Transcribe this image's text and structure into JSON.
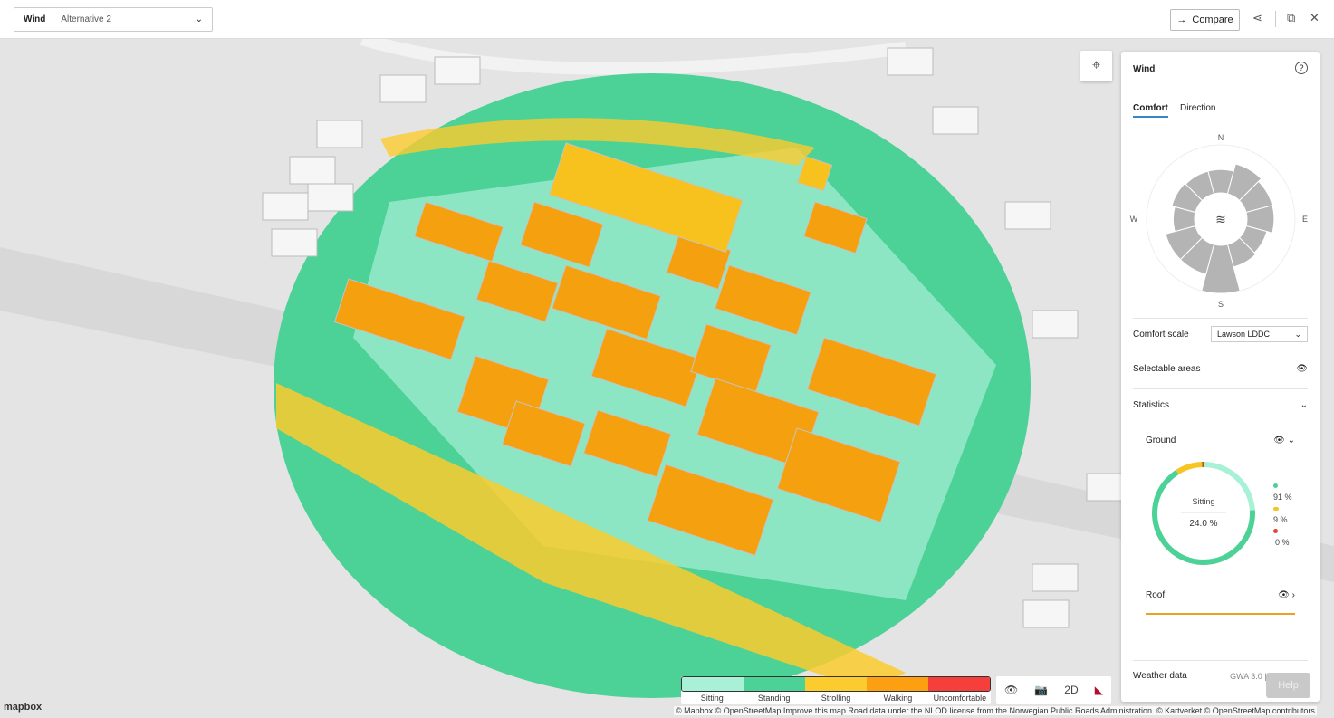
{
  "topbar": {
    "module": "Wind",
    "alternative": "Alternative 2",
    "compare_label": "Compare",
    "icons": [
      "chevron-down-icon",
      "arrow-right-icon",
      "share-icon",
      "popout-icon",
      "close-icon"
    ]
  },
  "panel": {
    "title": "Wind",
    "tabs": [
      {
        "label": "Comfort",
        "active": true
      },
      {
        "label": "Direction",
        "active": false
      }
    ],
    "rose": {
      "labels": {
        "n": "N",
        "e": "E",
        "s": "S",
        "w": "W"
      },
      "sector_values": [
        0.35,
        0.55,
        0.45,
        0.45,
        0.3,
        0.35,
        1.0,
        0.55,
        0.55,
        0.3,
        0.38,
        0.35
      ]
    },
    "comfort_scale_label": "Comfort scale",
    "comfort_scale_value": "Lawson LDDC",
    "selectable_areas": "Selectable areas",
    "statistics": "Statistics",
    "ground": {
      "label": "Ground",
      "center_label": "Sitting",
      "center_value": "24.0 %",
      "legend": [
        {
          "value": "91 %",
          "color": "#4cd197"
        },
        {
          "value": "9 %",
          "color": "#f5c623"
        },
        {
          "value": "0 %",
          "color": "#e8413b"
        }
      ],
      "donut": [
        {
          "name": "Sitting",
          "pct": 24.0,
          "color": "#a8f0d6"
        },
        {
          "name": "Standing",
          "pct": 67,
          "color": "#4cd197"
        },
        {
          "name": "Strolling",
          "pct": 8.5,
          "color": "#f5c623"
        },
        {
          "name": "Walking",
          "pct": 0.5,
          "color": "#b85c00"
        }
      ]
    },
    "roof": {
      "label": "Roof"
    },
    "weather_label": "Weather data",
    "weather_value": "GWA 3.0 | 1.0 | 1.75"
  },
  "legend": [
    {
      "label": "Sitting",
      "color": "#a8f0d6"
    },
    {
      "label": "Standing",
      "color": "#4cd197"
    },
    {
      "label": "Strolling",
      "color": "#fccb2e"
    },
    {
      "label": "Walking",
      "color": "#fc9f10"
    },
    {
      "label": "Uncomfortable",
      "color": "#f63f3a"
    }
  ],
  "tools": {
    "mode": "2D"
  },
  "help_label": "Help",
  "mapbox_logo": "mapbox",
  "attribution": "© Mapbox © OpenStreetMap Improve this map Road data under the NLOD license from the Norwegian Public Roads Administration. © Kartverket © OpenStreetMap contributors"
}
